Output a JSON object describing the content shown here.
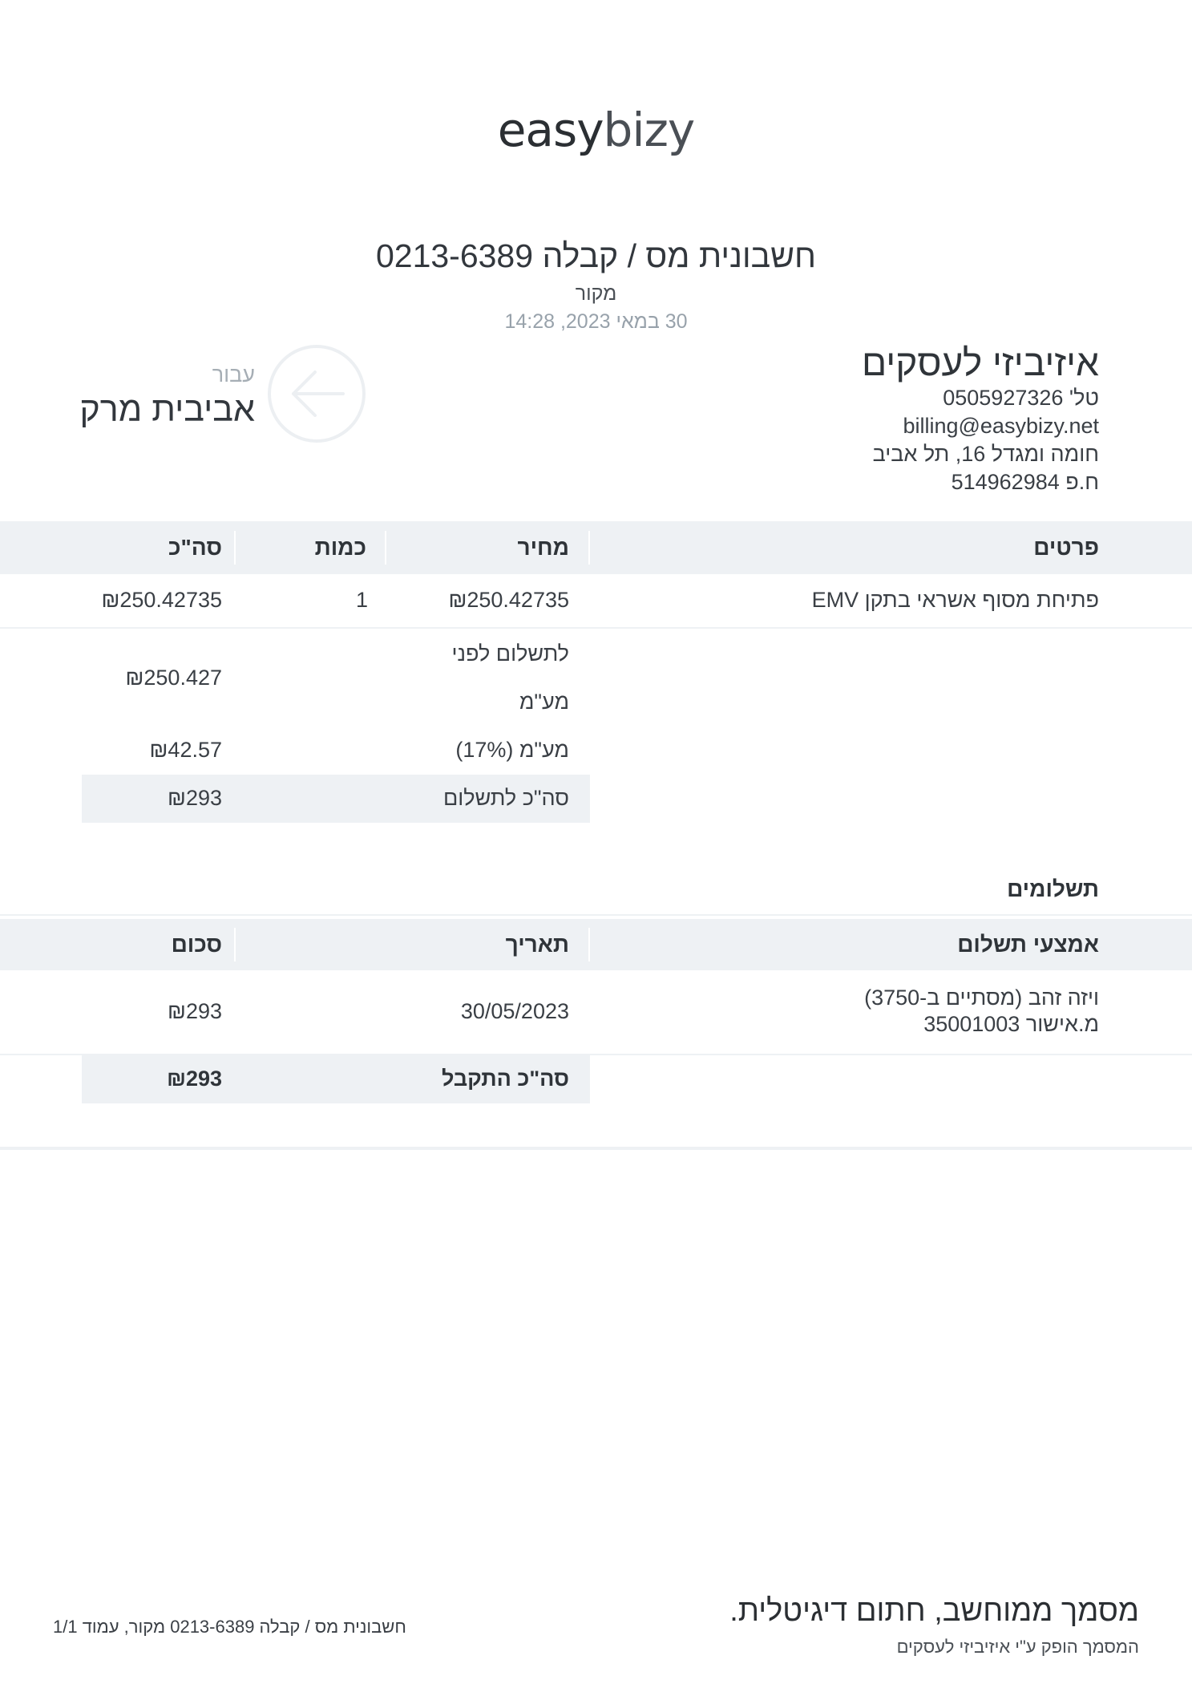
{
  "logo": {
    "part1": "easy",
    "part2": "bizy"
  },
  "document": {
    "title": "חשבונית מס / קבלה 0213-6389",
    "subtitle": "מקור",
    "date": "30 במאי 2023, 14:28"
  },
  "issuer": {
    "name": "איזיביזי לעסקים",
    "phone": "טל' 0505927326",
    "email": "billing@easybizy.net",
    "address": "חומה ומגדל 16, תל אביב",
    "company_id": "ח.פ 514962984"
  },
  "client": {
    "for_label": "עבור",
    "name": "אביבית מרק",
    "arrow_icon": "arrow-left-icon"
  },
  "items_table": {
    "headers": {
      "details": "פרטים",
      "price": "מחיר",
      "quantity": "כמות",
      "total": "סה\"כ"
    },
    "rows": [
      {
        "details": "פתיחת מסוף אשראי בתקן EMV",
        "price": "₪250.42735",
        "quantity": "1",
        "total": "₪250.42735"
      }
    ]
  },
  "summary": {
    "before_vat_label_line1": "לתשלום לפני",
    "before_vat_label_line2": "מע\"מ",
    "before_vat_value": "₪250.427",
    "vat_label": "מע\"מ (17%)",
    "vat_value": "₪42.57",
    "total_label": "סה\"כ לתשלום",
    "total_value": "₪293"
  },
  "payments": {
    "section_title": "תשלומים",
    "headers": {
      "method": "אמצעי תשלום",
      "date": "תאריך",
      "amount": "סכום"
    },
    "rows": [
      {
        "method_line1": "ויזה זהב (מסתיים ב-3750)",
        "method_line2": "מ.אישור 35001003",
        "date": "30/05/2023",
        "amount": "₪293"
      }
    ],
    "received_label": "סה\"כ התקבל",
    "received_value": "₪293"
  },
  "footer": {
    "signed": "מסמך ממוחשב, חתום דיגיטלית.",
    "issued_by": "המסמך הופק ע\"י איזיביזי לעסקים",
    "page_info": "חשבונית מס / קבלה 0213-6389 מקור, עמוד 1/1"
  },
  "colors": {
    "band": "#eef1f4",
    "muted": "#98a2ab",
    "text": "#3a3f45"
  }
}
